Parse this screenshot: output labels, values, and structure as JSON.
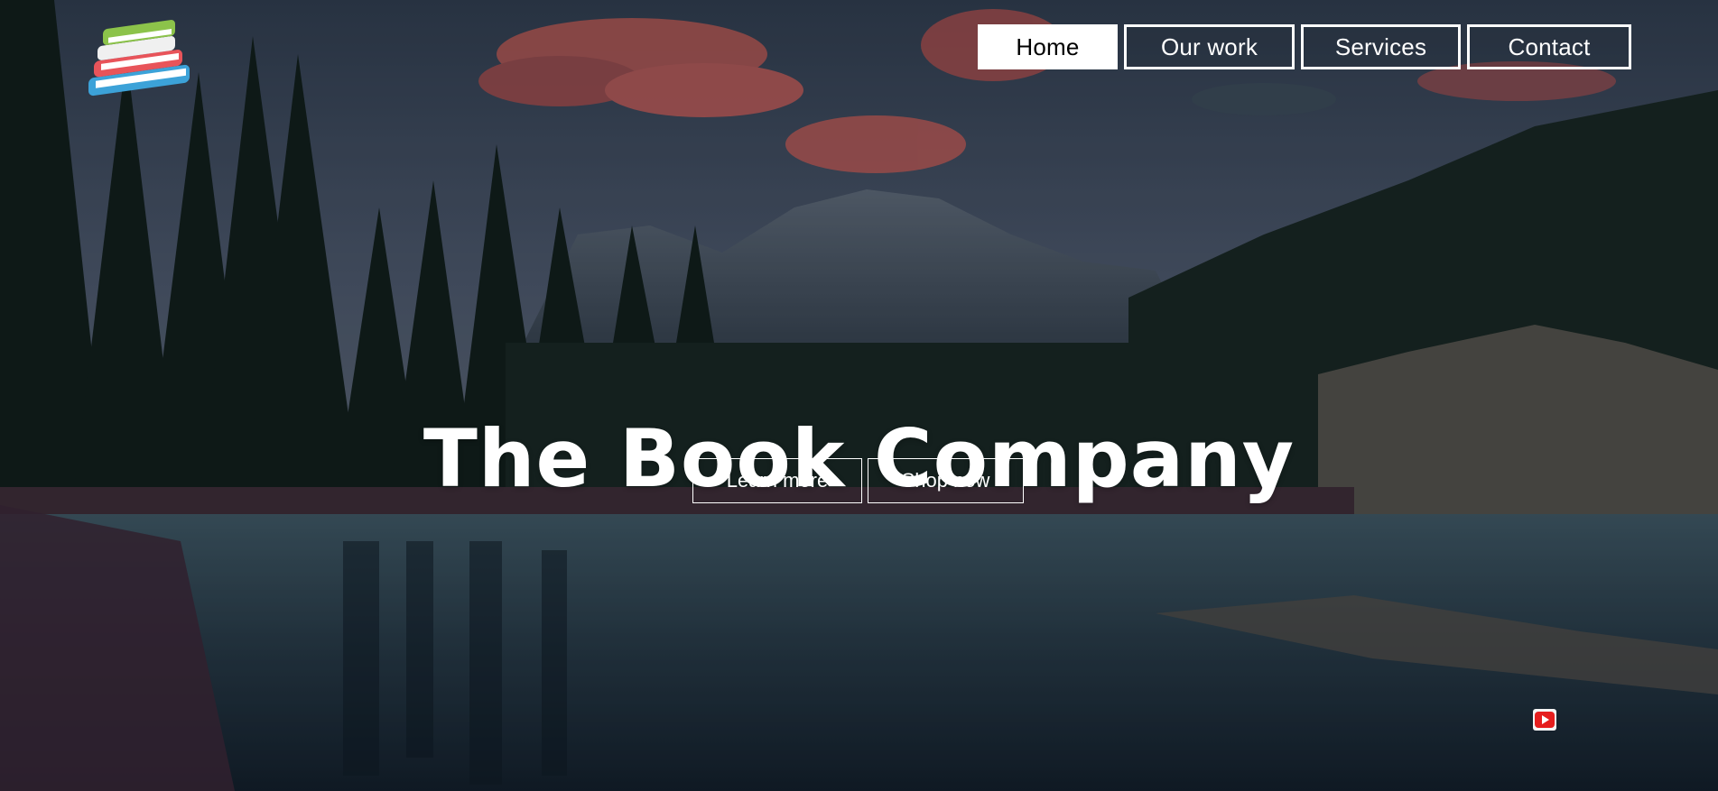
{
  "brand": {
    "logo_icon": "books-stack-icon"
  },
  "nav": {
    "items": [
      {
        "label": "Home",
        "active": true
      },
      {
        "label": "Our work",
        "active": false
      },
      {
        "label": "Services",
        "active": false
      },
      {
        "label": "Contact",
        "active": false
      }
    ]
  },
  "hero": {
    "title": "The Book Company",
    "buttons": {
      "learn_more": "Learn more",
      "shop_now": "Shop now"
    }
  },
  "social": {
    "youtube_icon": "youtube-icon",
    "youtube_color": "#e61e1e"
  },
  "colors": {
    "text": "#ffffff",
    "active_nav_bg": "#ffffff",
    "active_nav_text": "#000000"
  }
}
